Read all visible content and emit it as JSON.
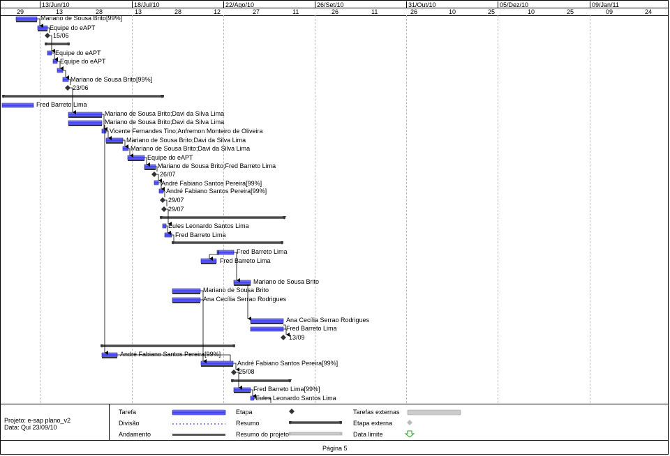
{
  "header": {
    "top": [
      "13/Jun/10",
      "18/Jul/10",
      "22/Ago/10",
      "26/Set/10",
      "31/Out/10",
      "05/Dez/10",
      "09/Jan/11"
    ],
    "bottom": [
      "29",
      "13",
      "28",
      "13",
      "28",
      "12",
      "27",
      "11",
      "26",
      "11",
      "26",
      "10",
      "25",
      "10",
      "25",
      "09",
      "24"
    ]
  },
  "tasks": {
    "t1": "Mariano de Sousa Brito[99%]",
    "t2": "Equipe do eAPT",
    "t3": "15/06",
    "t4": "Equipe do eAPT",
    "t5": "Equipe do eAPT",
    "t6": "Mariano de Sousa Brito[99%]",
    "t7": "23/06",
    "t8": "Fred Barreto Lima",
    "t9": "Mariano de Sousa Brito;Davi da Silva Lima",
    "t10": "Mariano de Sousa Brito;Davi da Silva Lima",
    "t11": "Vicente Fernandes Tino;Anfremon Monteiro de Oliveira",
    "t12": "Mariano de Sousa Brito;Davi da Silva Lima",
    "t13": "Mariano de Sousa Brito;Davi da Silva Lima",
    "t14": "Equipe do eAPT",
    "t15": "Mariano de Sousa Brito;Fred Barreto Lima",
    "t16": "26/07",
    "t17": "André Fabiano Santos Pereira[99%]",
    "t18": "André Fabiano Santos Pereira[99%]",
    "t19": "29/07",
    "t20": "29/07",
    "t21": "Eules Leonardo Santos Lima",
    "t22": "Fred Barreto Lima",
    "t23": "Fred Barreto Lima",
    "t24": "Fred Barreto Lima",
    "t25": "Mariano de Sousa Brito",
    "t26": "Mariano de Sousa Brito",
    "t27": "Ana Cecília Serrao Rodrigues",
    "t28": "Ana Cecília Serrao Rodrigues",
    "t29": "Fred Barreto Lima",
    "t30": "13/09",
    "t31": "André Fabiano Santos Pereira[99%]",
    "t32": "André Fabiano Santos Pereira[99%]",
    "t33": "25/08",
    "t34": "Fred Barreto Lima[99%]",
    "t35": "Eules Leonardo Santos Lima"
  },
  "legend": {
    "project": "Projeto: e-sap plano_v2",
    "date": "Data: Qui 23/09/10",
    "tarefa": "Tarefa",
    "divisao": "Divisão",
    "andamento": "Andamento",
    "etapa": "Etapa",
    "resumo": "Resumo",
    "resumo_projeto": "Resumo do projeto",
    "tarefas_externas": "Tarefas externas",
    "etapa_externa": "Etapa externa",
    "data_limite": "Data limite"
  },
  "footer": {
    "page": "Página 5"
  },
  "colors": {
    "task": "#4a4ae8",
    "summary": "#555555",
    "arrow": "#1a1acc"
  }
}
